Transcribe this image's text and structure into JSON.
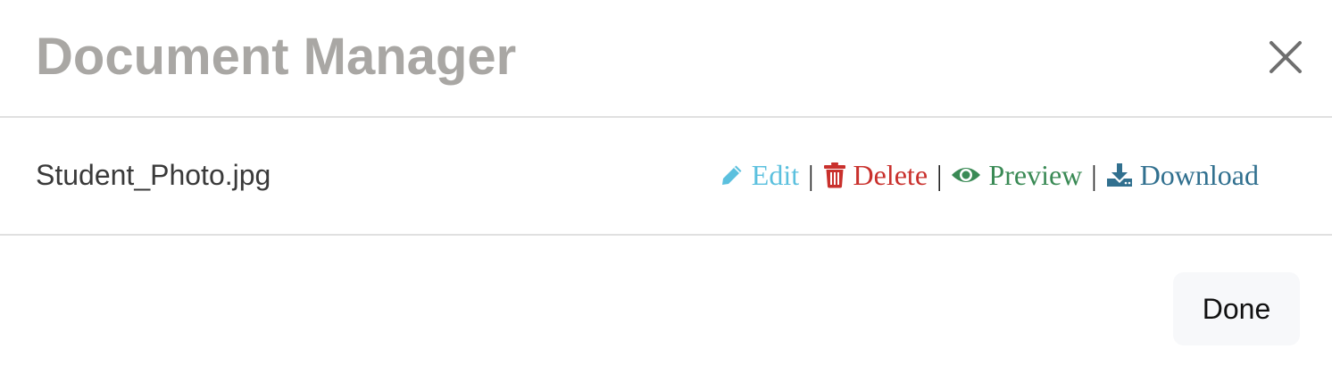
{
  "modal": {
    "title": "Document Manager",
    "close_icon": "close-icon"
  },
  "file": {
    "name": "Student_Photo.jpg"
  },
  "actions": {
    "separator": "|",
    "edit": {
      "label": "Edit",
      "icon": "pencil-icon",
      "color": "#5bc0de"
    },
    "delete": {
      "label": "Delete",
      "icon": "trash-icon",
      "color": "#c9302c"
    },
    "preview": {
      "label": "Preview",
      "icon": "eye-icon",
      "color": "#3a8a55"
    },
    "download": {
      "label": "Download",
      "icon": "download-icon",
      "color": "#31708f"
    }
  },
  "footer": {
    "done_label": "Done"
  }
}
